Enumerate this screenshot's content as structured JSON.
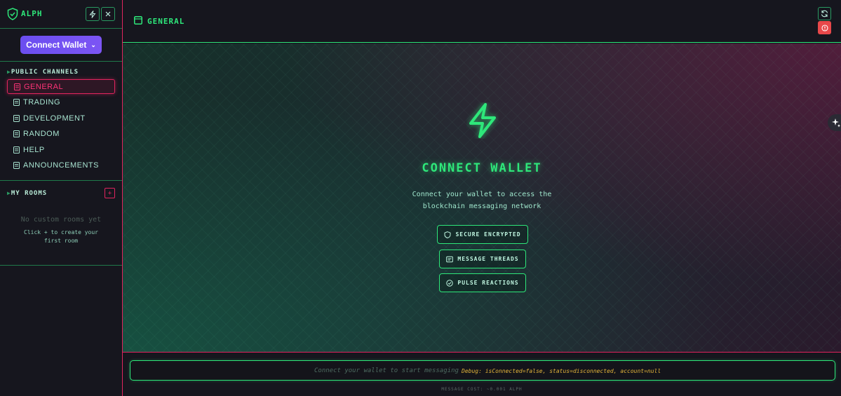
{
  "app": {
    "name": "ALPH"
  },
  "wallet": {
    "connect_label": "Connect Wallet"
  },
  "sidebar": {
    "public_title": "PUBLIC CHANNELS",
    "channels": [
      {
        "label": "GENERAL",
        "active": true
      },
      {
        "label": "TRADING"
      },
      {
        "label": "DEVELOPMENT"
      },
      {
        "label": "RANDOM"
      },
      {
        "label": "HELP"
      },
      {
        "label": "ANNOUNCEMENTS"
      }
    ],
    "rooms_title": "MY ROOMS",
    "add_room_label": "+",
    "empty_rooms": "No custom rooms yet",
    "empty_hint": "Click + to create your first room"
  },
  "header": {
    "channel_title": "GENERAL"
  },
  "main": {
    "title": "CONNECT WALLET",
    "description": "Connect your wallet to access the blockchain messaging network",
    "features": [
      {
        "label": "SECURE ENCRYPTED",
        "icon": "shield-icon"
      },
      {
        "label": "MESSAGE THREADS",
        "icon": "message-icon"
      },
      {
        "label": "PULSE REACTIONS",
        "icon": "check-circle-icon"
      }
    ]
  },
  "footer": {
    "placeholder": "Connect your wallet to start messaging",
    "debug": "Debug: isConnected=false, status=disconnected, account=null",
    "cost": "MESSAGE COST: ~0.001 ALPH"
  },
  "colors": {
    "accent_green": "#2ee77a",
    "accent_pink": "#e0245e",
    "wallet_purple": "#6b4ef0",
    "alert_red": "#e8484a"
  }
}
